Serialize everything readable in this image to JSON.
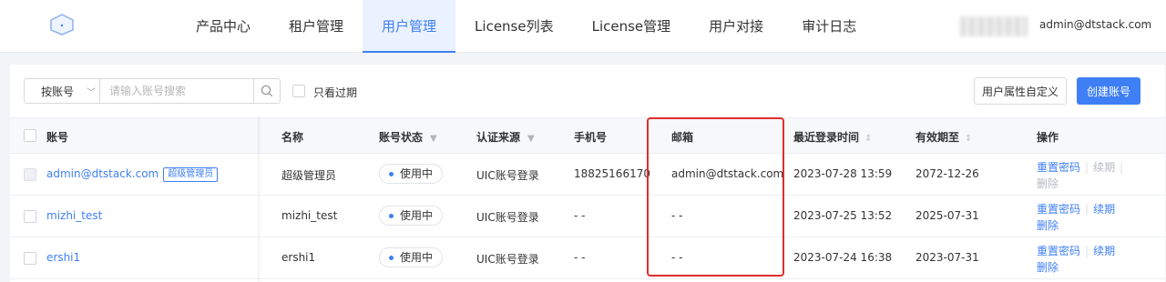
{
  "nav": {
    "items": [
      "产品中心",
      "租户管理",
      "用户管理",
      "License列表",
      "License管理",
      "用户对接",
      "审计日志"
    ],
    "active": "用户管理",
    "user": "admin@dtstack.com"
  },
  "toolbar": {
    "filter_select": "按账号",
    "search_placeholder": "请输入账号搜索",
    "expired_only": "只看过期",
    "custom_attr_button": "用户属性自定义",
    "create_button": "创建账号"
  },
  "table": {
    "headers": {
      "account": "账号",
      "name": "名称",
      "status": "账号状态",
      "source": "认证来源",
      "phone": "手机号",
      "email": "邮箱",
      "last_login": "最近登录时间",
      "valid_until": "有效期至",
      "actions": "操作"
    },
    "rows": [
      {
        "account": "admin@dtstack.com",
        "tag": "超级管理员",
        "name": "超级管理员",
        "status": "使用中",
        "source": "UIC账号登录",
        "phone": "18825166170",
        "email": "admin@dtstack.com",
        "last_login": "2023-07-28 13:59",
        "valid_until": "2072-12-26",
        "action_reset": "重置密码",
        "action_renew": "续期",
        "action_delete": "删除"
      },
      {
        "account": "mizhi_test",
        "tag": "",
        "name": "mizhi_test",
        "status": "使用中",
        "source": "UIC账号登录",
        "phone": "- -",
        "email": "- -",
        "last_login": "2023-07-25 13:52",
        "valid_until": "2025-07-31",
        "action_reset": "重置密码",
        "action_renew": "续期",
        "action_delete": "删除"
      },
      {
        "account": "ershi1",
        "tag": "",
        "name": "ershi1",
        "status": "使用中",
        "source": "UIC账号登录",
        "phone": "- -",
        "email": "- -",
        "last_login": "2023-07-24 16:38",
        "valid_until": "2023-07-31",
        "action_reset": "重置密码",
        "action_renew": "续期",
        "action_delete": "删除"
      }
    ]
  },
  "colors": {
    "accent": "#3f7ff5",
    "highlight": "#e02d2d"
  }
}
